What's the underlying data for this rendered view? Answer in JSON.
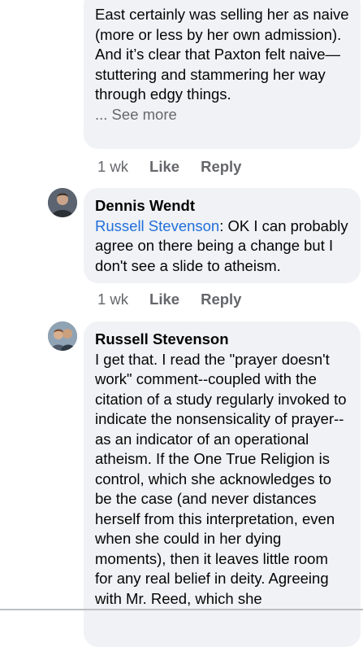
{
  "comments": [
    {
      "text": " East certainly was selling her as naive (more or less by her own admission). And it’s clear that Paxton felt naive—stuttering and stammering her way through edgy things.",
      "see_more": "... See more",
      "time": "1 wk",
      "like_label": "Like",
      "reply_label": "Reply"
    },
    {
      "author": "Dennis Wendt",
      "mention": "Russell Stevenson",
      "text": ": OK I can probably agree on there being a change but I don't see a slide to atheism.",
      "time": "1 wk",
      "like_label": "Like",
      "reply_label": "Reply"
    },
    {
      "author": "Russell Stevenson",
      "text": "I get that. I read the \"prayer doesn't work\" comment--coupled with the citation of a study regularly invoked to indicate the nonsensicality of prayer--as an indicator of an operational atheism. If the One True Religion is control, which she acknowledges to be the case (and never distances herself from this interpretation, even when she could in her dying moments), then it leaves little room for any real belief in deity. Agreeing with Mr. Reed, which she"
    }
  ]
}
